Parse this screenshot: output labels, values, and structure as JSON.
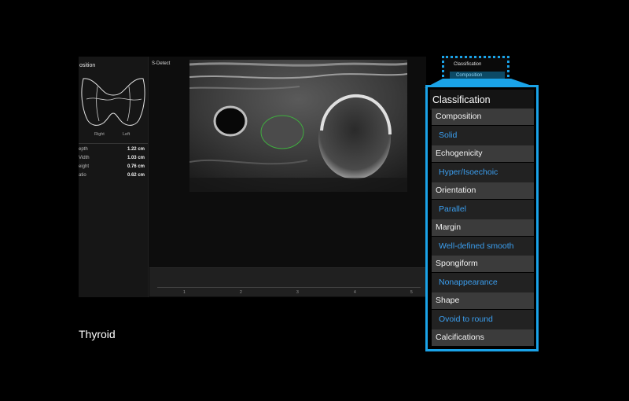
{
  "screen": {
    "panel_title": "osition",
    "diagram_labels": {
      "right": "Right",
      "left": "Left"
    },
    "measurements": [
      {
        "name": "epth",
        "value": "1.22 cm"
      },
      {
        "name": "Vidth",
        "value": "1.03 cm"
      },
      {
        "name": "eight",
        "value": "0.76 cm"
      },
      {
        "name": "atio",
        "value": "0.62 cm"
      }
    ],
    "mode_label": "S-Detect",
    "timeline_ticks": [
      "1",
      "2",
      "3",
      "4",
      "5"
    ]
  },
  "caption": "Thyroid",
  "zoom": {
    "title": "Classification",
    "selected_item": "Composition"
  },
  "classification": {
    "header": "Classification",
    "rows": [
      {
        "category": "Composition",
        "value": "Solid"
      },
      {
        "category": "Echogenicity",
        "value": "Hyper/Isoechoic"
      },
      {
        "category": "Orientation",
        "value": "Parallel"
      },
      {
        "category": "Margin",
        "value": "Well-defined smooth"
      },
      {
        "category": "Spongiform",
        "value": "Nonappearance"
      },
      {
        "category": "Shape",
        "value": "Ovoid to round"
      },
      {
        "category": "Calcifications",
        "value": ""
      }
    ]
  },
  "colors": {
    "accent": "#1aa3e8",
    "value_text": "#3b9ff0",
    "nodule_outline": "#3fae3f"
  }
}
